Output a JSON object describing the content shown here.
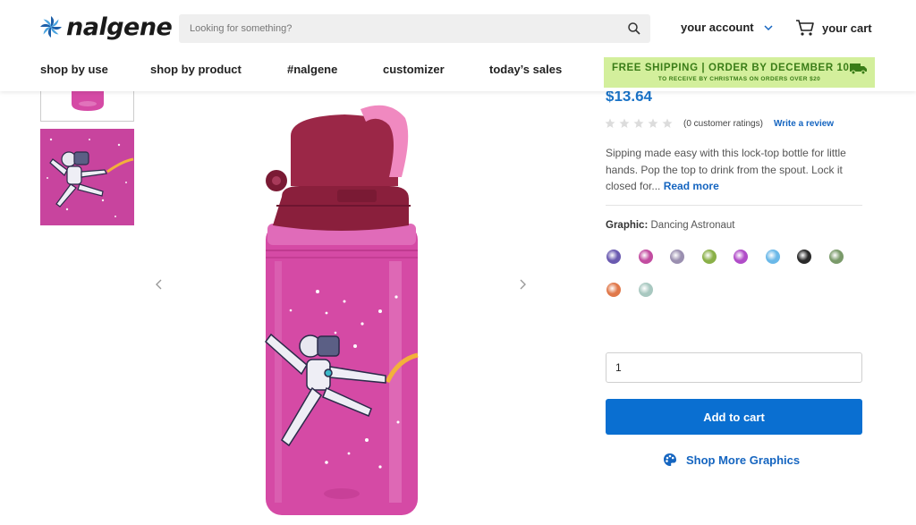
{
  "header": {
    "logo_text": "nalgene",
    "search_placeholder": "Looking for something?",
    "account_label": "your account",
    "cart_label": "your cart"
  },
  "nav": {
    "items": [
      "shop by use",
      "shop by product",
      "#nalgene",
      "customizer",
      "today’s sales"
    ]
  },
  "promo": {
    "main": "FREE SHIPPING | ORDER BY DECEMBER 10",
    "sub": "TO RECEIVE BY CHRISTMAS ON ORDERS OVER $20"
  },
  "product": {
    "price": "$13.64",
    "rating_stars": 0,
    "ratings_text": "(0 customer ratings)",
    "write_review": "Write a review",
    "description": "Sipping made easy with this lock-top bottle for little hands. Pop the top to drink from the spout. Lock it closed for...",
    "read_more": "Read more",
    "graphic_label": "Graphic:",
    "graphic_value": "Dancing Astronaut",
    "quantity": "1",
    "add_to_cart": "Add to cart",
    "shop_more": "Shop More Graphics"
  },
  "swatches": [
    "#6a5ab0",
    "#c24ca0",
    "#9a8fb0",
    "#8ab048",
    "#b04cc8",
    "#6ab8e8",
    "#2a2a2a",
    "#7a9a6a",
    "#e0784a",
    "#a8c8c0"
  ],
  "colors": {
    "accent_blue": "#0a6fd1",
    "price_blue": "#1a73c7",
    "promo_green": "#d3ef9c",
    "bottle_pink": "#d54aa5",
    "cap_maroon": "#8a1f3c"
  }
}
